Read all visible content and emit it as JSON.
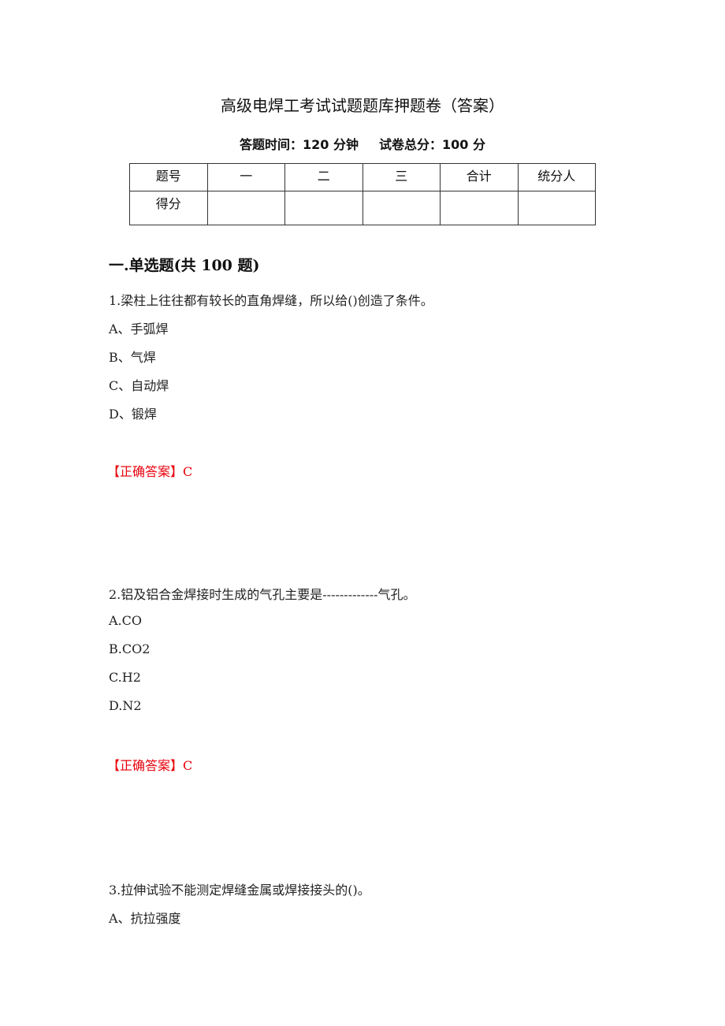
{
  "document": {
    "title": "高级电焊工考试试题题库押题卷（答案）",
    "exam_time": "答题时间：120 分钟",
    "total_score": "试卷总分：100 分"
  },
  "score_table": {
    "header": [
      "题号",
      "一",
      "二",
      "三",
      "合计",
      "统分人"
    ],
    "row_label": "得分",
    "row_values": [
      "",
      "",
      "",
      "",
      ""
    ]
  },
  "section": {
    "title": "一.单选题(共 100 题)"
  },
  "questions": [
    {
      "stem": "1.梁柱上往往都有较长的直角焊缝，所以给()创造了条件。",
      "options": [
        "A、手弧焊",
        "B、气焊",
        "C、自动焊",
        "D、锻焊"
      ],
      "answer": "【正确答案】C"
    },
    {
      "stem": "2.铝及铝合金焊接时生成的气孔主要是-------------气孔。",
      "options": [
        "A.CO",
        "B.CO2",
        "C.H2",
        "D.N2"
      ],
      "answer": "【正确答案】C"
    },
    {
      "stem": "3.拉伸试验不能测定焊缝金属或焊接接头的()。",
      "options": [
        "A、抗拉强度"
      ]
    }
  ],
  "colors": {
    "answer": "#e8000b",
    "text": "#222222"
  }
}
